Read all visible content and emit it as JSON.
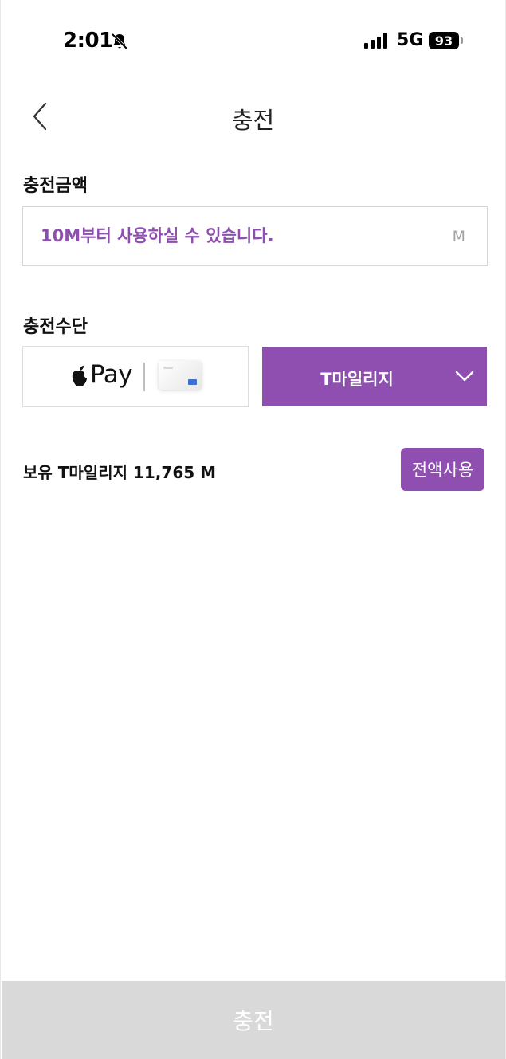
{
  "status_bar": {
    "time": "2:01",
    "network": "5G",
    "battery": "93",
    "icons": [
      "bell-slash-icon",
      "signal-icon"
    ]
  },
  "header": {
    "back_icon": "chevron-left-icon",
    "title": "충전"
  },
  "amount_section": {
    "label": "충전금액",
    "placeholder": "10M부터 사용하실 수 있습니다.",
    "value": "",
    "unit": "M"
  },
  "method_section": {
    "label": "충전수단",
    "apple_pay": {
      "icon": "apple-icon",
      "label": "Pay"
    },
    "mileage": {
      "label": "T마일리지",
      "icon": "chevron-down-icon"
    }
  },
  "balance": {
    "text": "보유 T마일리지 11,765 M",
    "use_all_label": "전액사용"
  },
  "footer": {
    "charge_label": "충전"
  },
  "colors": {
    "accent": "#8e4fb0",
    "disabled_button": "#d9d9d9",
    "border": "#d6d6d6"
  }
}
